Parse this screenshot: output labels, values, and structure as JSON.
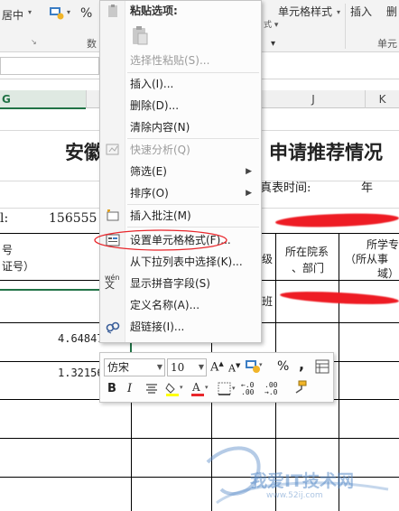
{
  "ribbon": {
    "merge_center": "居中",
    "percent": "%",
    "number_group": "数",
    "cell_styles": "单元格样式",
    "insert": "插入",
    "delete": "删",
    "cells_group": "单元",
    "style_dropdown_text": "式"
  },
  "columns": {
    "g": "G",
    "j": "J",
    "k": "K"
  },
  "sheet": {
    "title_left": "安徽",
    "title_right": "申请推荐情况",
    "fill_time_label": "真表时间:",
    "fill_time_year": "年",
    "phone_label": "l:",
    "phone_partial": "156555",
    "col_no_header_1": "号",
    "col_no_header_2": "证号）",
    "col_level_header": "级",
    "dept_header_1": "所在院系",
    "dept_header_2": "、部门",
    "major_header_1": "所学专",
    "major_header_2": "（所从事",
    "major_header_3": "域）",
    "row1_class": "班",
    "value_1": "4.64847",
    "value_2": "1.32156"
  },
  "context_menu": {
    "header": "粘贴选项:",
    "items": [
      {
        "label": "选择性粘贴(S)...",
        "disabled": true
      },
      {
        "label": "插入(I)...",
        "disabled": false
      },
      {
        "label": "删除(D)...",
        "disabled": false
      },
      {
        "label": "清除内容(N)",
        "disabled": false
      },
      {
        "label": "快速分析(Q)",
        "disabled": true
      },
      {
        "label": "筛选(E)",
        "disabled": false
      },
      {
        "label": "排序(O)",
        "disabled": false
      },
      {
        "label": "插入批注(M)",
        "disabled": false
      },
      {
        "label": "设置单元格格式(F)...",
        "disabled": false
      },
      {
        "label": "从下拉列表中选择(K)...",
        "disabled": false
      },
      {
        "label": "显示拼音字段(S)",
        "disabled": false
      },
      {
        "label": "定义名称(A)...",
        "disabled": false
      },
      {
        "label": "超链接(I)...",
        "disabled": false
      }
    ],
    "pinyin_icon_text": "wén"
  },
  "mini_toolbar": {
    "font_name": "仿宋",
    "font_size": "10",
    "percent": "%",
    "comma": ",",
    "bold": "B",
    "italic": "I",
    "decimal_increase": "+.0\n.00",
    "decimal_decrease": ".00\n→.0"
  },
  "watermark": {
    "text": "我爱IT技术网",
    "url": "www.52ij.com"
  },
  "colors": {
    "excel_green": "#217346",
    "annotation_red": "#e8262b",
    "redaction_red": "#ee1c24",
    "disabled_text": "#9c9c9c"
  }
}
